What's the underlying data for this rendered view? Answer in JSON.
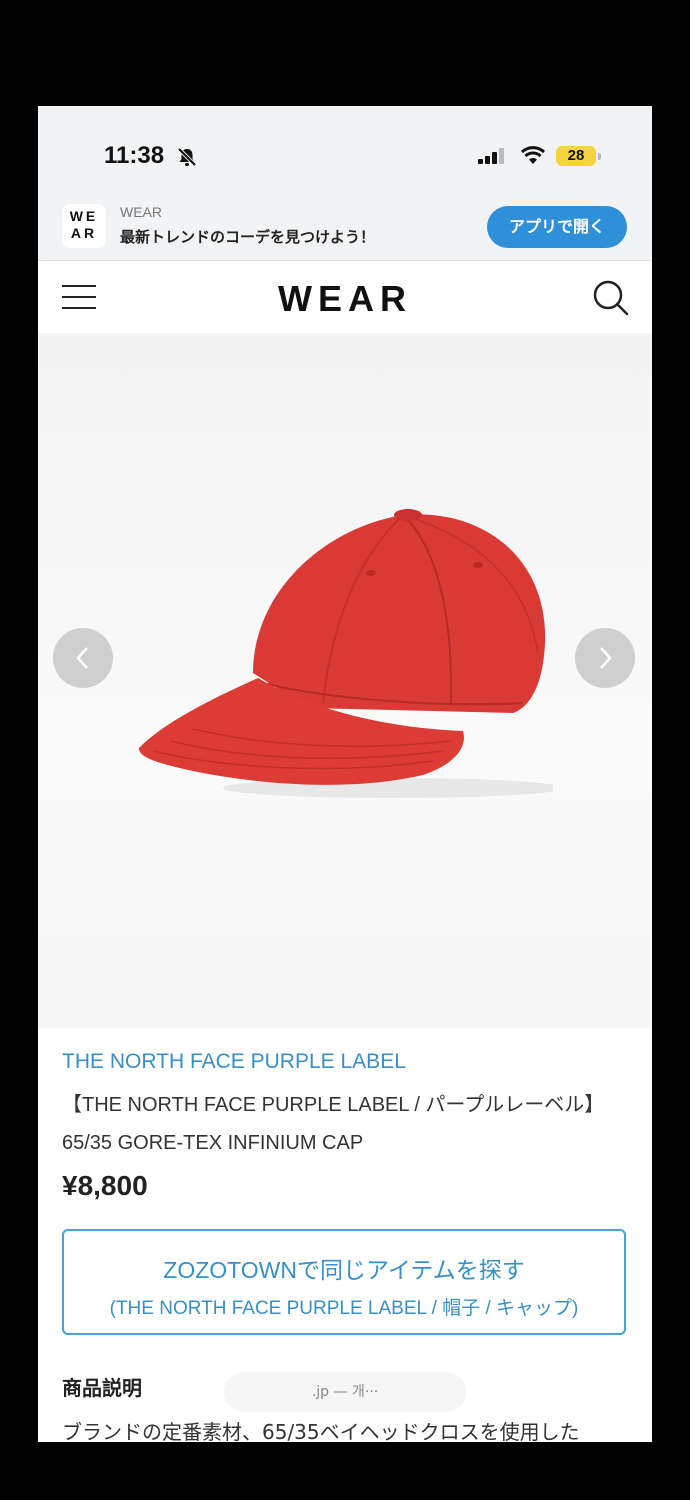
{
  "status_bar": {
    "time": "11:38",
    "battery": "28"
  },
  "app_banner": {
    "logo_line1": "WE",
    "logo_line2": "AR",
    "app_name": "WEAR",
    "tagline": "最新トレンドのコーデを見つけよう！",
    "open_button": "アプリで開く"
  },
  "header": {
    "logo": "WEAR"
  },
  "product": {
    "brand": "THE NORTH FACE PURPLE LABEL",
    "title": "【THE NORTH FACE PURPLE LABEL / パープルレーベル】 65/35 GORE-TEX INFINIUM CAP",
    "price": "¥8,800",
    "image_color": "#d93a35"
  },
  "zozo_button": {
    "main": "ZOZOTOWNで同じアイテムを探す",
    "sub": "(THE NORTH FACE PURPLE LABEL / 帽子 / キャップ)"
  },
  "description": {
    "heading": "商品説明",
    "text": "ブランドの定番素材、65/35ベイヘッドクロスを使用した"
  },
  "url_pill": ".jp — 개···",
  "colors": {
    "accent": "#3a8fc4",
    "banner_button": "#2f8fd8",
    "battery": "#f4d43c"
  }
}
